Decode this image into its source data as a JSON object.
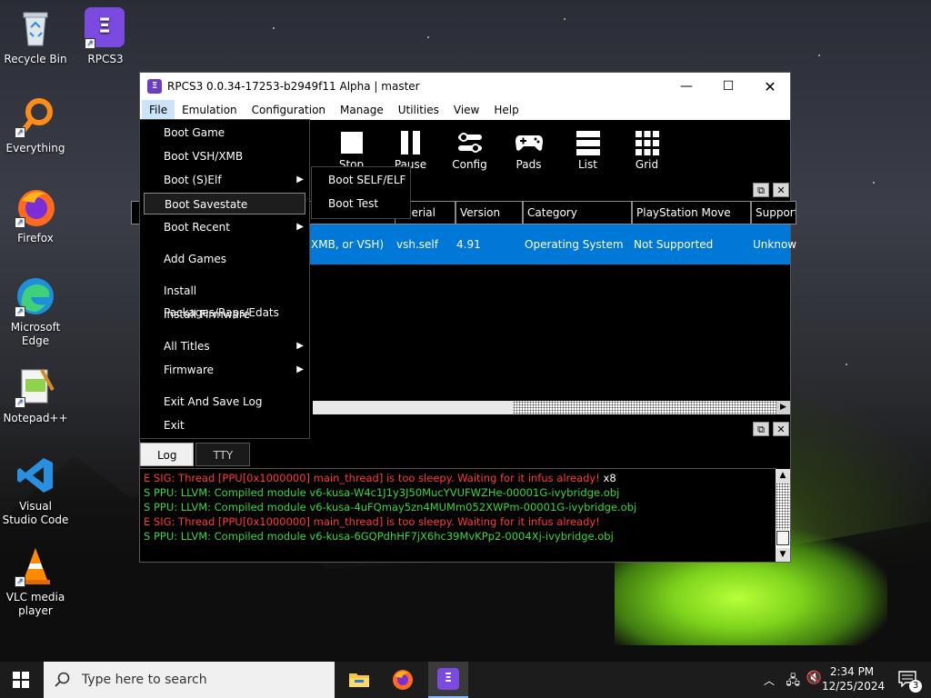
{
  "desktop": {
    "icons": [
      {
        "label": "Recycle Bin",
        "icon": "recycle-bin-icon"
      },
      {
        "label": "RPCS3",
        "icon": "rpcs3-icon"
      },
      {
        "label": "Everything",
        "icon": "everything-icon"
      },
      {
        "label": "Firefox",
        "icon": "firefox-icon"
      },
      {
        "label": "Microsoft Edge",
        "icon": "edge-icon"
      },
      {
        "label": "Notepad++",
        "icon": "notepadpp-icon"
      },
      {
        "label": "Visual Studio Code",
        "icon": "vscode-icon"
      },
      {
        "label": "VLC media player",
        "icon": "vlc-icon"
      }
    ]
  },
  "window": {
    "title": "RPCS3 0.0.34-17253-b2949f11 Alpha | master",
    "menubar": [
      "File",
      "Emulation",
      "Configuration",
      "Manage",
      "Utilities",
      "View",
      "Help"
    ],
    "toolbar": [
      "Stop",
      "Pause",
      "Config",
      "Pads",
      "List",
      "Grid"
    ],
    "game_list": {
      "headers": [
        "Serial",
        "Version",
        "Category",
        "PlayStation Move",
        "Support"
      ],
      "row": {
        "name": "XMB, or VSH)",
        "serial": "vsh.self",
        "version": "4.91",
        "category": "Operating System",
        "move": "Not Supported",
        "support": "Unknow"
      }
    },
    "log": {
      "tabs": [
        "Log",
        "TTY"
      ],
      "lines": [
        {
          "text": "E SIG: Thread [PPU[0x1000000] main_thread] is too sleepy. Waiting for it infus already!",
          "suffix": " x8",
          "color": "#ff3a3a"
        },
        {
          "text": "S PPU: LLVM: Compiled module v6-kusa-W4c1J1y3J50MucYVUFWZHe-00001G-ivybridge.obj",
          "suffix": "",
          "color": "#3ad63a"
        },
        {
          "text": "S PPU: LLVM: Compiled module v6-kusa-4uFQmay5zn4MUMm052XWPm-00001G-ivybridge.obj",
          "suffix": "",
          "color": "#3ad63a"
        },
        {
          "text": "E SIG: Thread [PPU[0x1000000] main_thread] is too sleepy. Waiting for it infus already!",
          "suffix": "",
          "color": "#ff3a3a"
        },
        {
          "text": "S PPU: LLVM: Compiled module v6-kusa-6GQPdhHF7jX6hc39MvKPp2-0004Xj-ivybridge.obj",
          "suffix": "",
          "color": "#3ad63a"
        }
      ]
    }
  },
  "file_menu": {
    "items": [
      "Boot Game",
      "Boot VSH/XMB",
      "Boot (S)Elf",
      "Boot Savestate",
      "Boot Recent",
      "Add Games",
      "Install Packages/Raps/Edats",
      "Install Firmware",
      "All Titles",
      "Firmware",
      "Exit And Save Log",
      "Exit"
    ],
    "submenu": [
      "Boot SELF/ELF",
      "Boot Test"
    ]
  },
  "taskbar": {
    "search_placeholder": "Type here to search",
    "time": "2:34 PM",
    "date": "12/25/2024",
    "notification_count": "3"
  }
}
